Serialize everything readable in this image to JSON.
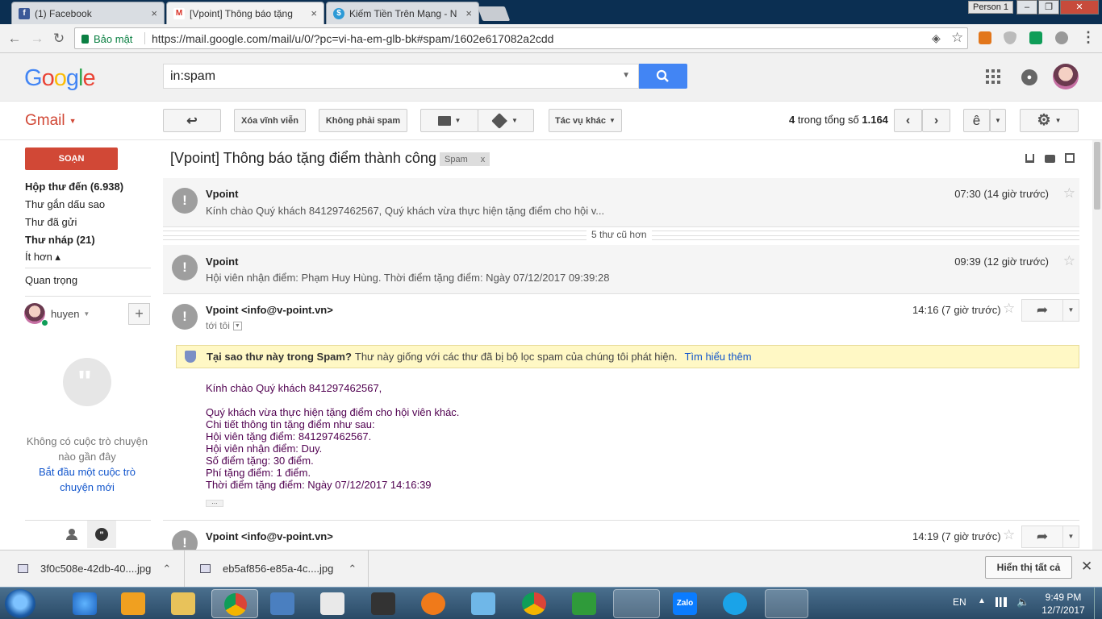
{
  "browser": {
    "tabs": [
      {
        "title": "(1) Facebook",
        "favicon": "f",
        "color": "#3b5998"
      },
      {
        "title": "[Vpoint] Thông báo tặng",
        "favicon": "M",
        "color": "#d93025"
      },
      {
        "title": "Kiếm Tiền Trên Mạng - N",
        "favicon": "$",
        "color": "#2c9ad6"
      }
    ],
    "profile": "Person 1",
    "security_label": "Bảo mật",
    "url": "https://mail.google.com/mail/u/0/?pc=vi-ha-em-glb-bk#spam/1602e617082a2cdd"
  },
  "gmail": {
    "logo": "Google",
    "search_value": "in:spam",
    "app_label": "Gmail",
    "toolbar": {
      "delete_forever": "Xóa vĩnh viễn",
      "not_spam": "Không phải spam",
      "more_actions": "Tác vụ khác",
      "count_prefix": "4",
      "count_mid": "trong tổng số",
      "count_total": "1.164",
      "input_tool": "ê"
    },
    "compose": "SOẠN",
    "nav": [
      {
        "label": "Hộp thư đến (6.938)",
        "bold": true
      },
      {
        "label": "Thư gắn dấu sao",
        "bold": false
      },
      {
        "label": "Thư đã gửi",
        "bold": false
      },
      {
        "label": "Thư nháp (21)",
        "bold": true
      },
      {
        "label": "Ít hơn ▴",
        "bold": false
      },
      {
        "label": "Quan trọng",
        "bold": false
      }
    ],
    "hangouts": {
      "user": "huyen",
      "empty_line1": "Không có cuộc trò chuyện",
      "empty_line2": "nào gần đây",
      "start_line1": "Bắt đầu một cuộc trò",
      "start_line2": "chuyện mới"
    },
    "thread": {
      "subject": "[Vpoint] Thông báo tặng điểm thành công",
      "label": "Spam",
      "collapsed_count": "5 thư cũ hơn",
      "messages": [
        {
          "sender": "Vpoint",
          "snippet": "Kính chào Quý khách 841297462567, Quý khách vừa thực hiện tặng điểm cho hội v...",
          "time": "07:30 (14 giờ trước)"
        },
        {
          "sender": "Vpoint",
          "snippet": "Hội viên nhận điểm: Phạm Huy Hùng. Thời điểm tặng điểm: Ngày 07/12/2017 09:39:28",
          "time": "09:39 (12 giờ trước)"
        },
        {
          "sender": "Vpoint <info@v-point.vn>",
          "to": "tới tôi",
          "time": "14:16 (7 giờ trước)"
        },
        {
          "sender": "Vpoint <info@v-point.vn>",
          "time": "14:19 (7 giờ trước)"
        }
      ],
      "spam_bold": "Tại sao thư này trong Spam?",
      "spam_text": "Thư này giống với các thư đã bị bộ lọc spam của chúng tôi phát hiện.",
      "spam_link": "Tìm hiểu thêm",
      "body": [
        "Kính chào Quý khách 841297462567,",
        "",
        "Quý khách vừa thực hiện tặng điểm cho hội viên khác.",
        "Chi tiết thông tin tặng điểm như sau:",
        "Hội viên tặng điểm: 841297462567.",
        "Hội viên nhận điểm: Duy.",
        "Số điểm tặng: 30 điểm.",
        "Phí tặng điểm: 1 điểm.",
        "Thời điểm tặng điểm: Ngày 07/12/2017 14:16:39"
      ]
    }
  },
  "downloads": {
    "items": [
      "3f0c508e-42db-40....jpg",
      "eb5af856-e85a-4c....jpg"
    ],
    "show_all": "Hiển thị tất cả"
  },
  "taskbar": {
    "lang": "EN",
    "time": "9:49 PM",
    "date": "12/7/2017"
  },
  "colors": {
    "gmail_red": "#d14836",
    "search_blue": "#4285f4",
    "spam_yellow": "#fff8c5"
  }
}
